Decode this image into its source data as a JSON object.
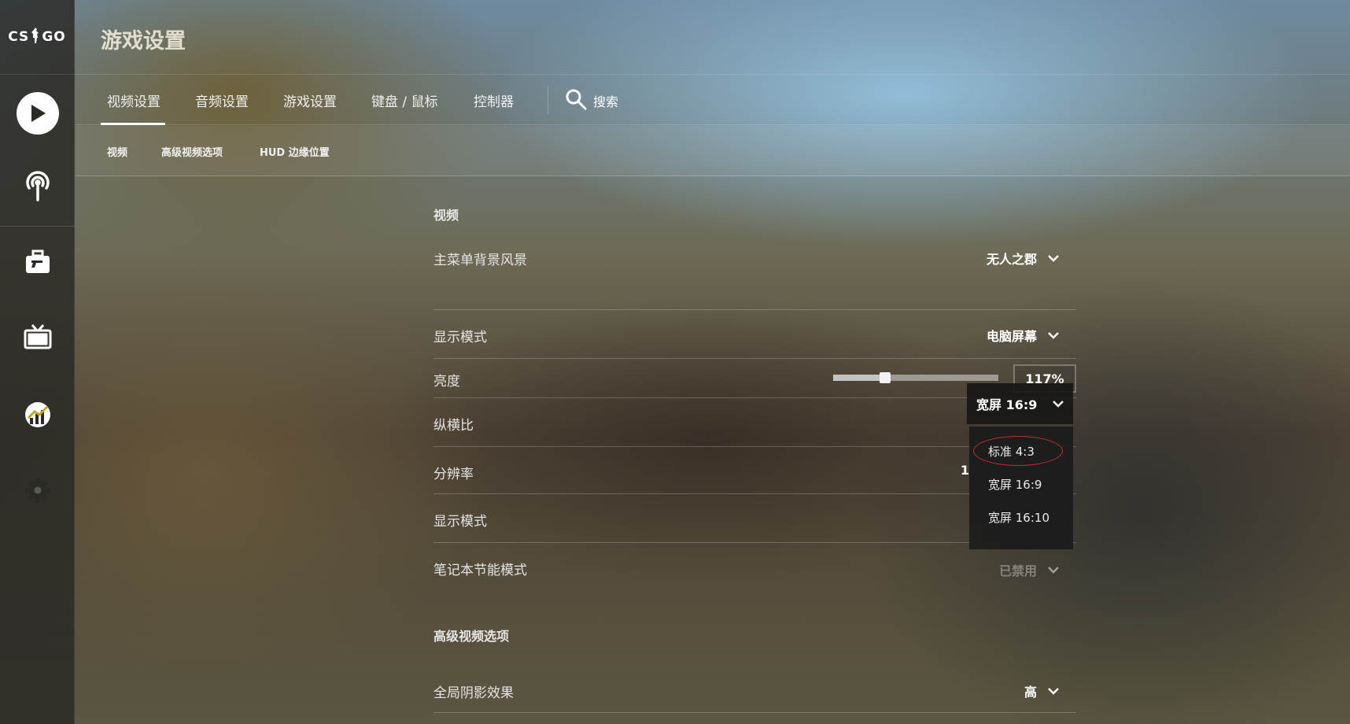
{
  "logo": {
    "left": "CS",
    "right": "GO"
  },
  "header": {
    "title": "游戏设置"
  },
  "tabs": [
    {
      "label": "视频设置",
      "active": true
    },
    {
      "label": "音频设置"
    },
    {
      "label": "游戏设置"
    },
    {
      "label": "键盘 / 鼠标"
    },
    {
      "label": "控制器"
    }
  ],
  "search": {
    "label": "搜索",
    "icon": "search-icon"
  },
  "subtabs": [
    {
      "label": "视频"
    },
    {
      "label": "高级视频选项"
    },
    {
      "label": "HUD 边缘位置"
    }
  ],
  "sections": {
    "video": "视频",
    "advanced": "高级视频选项"
  },
  "settings": {
    "menu_background": {
      "label": "主菜单背景风景",
      "value": "无人之郡"
    },
    "display_mode": {
      "label": "显示模式",
      "value": "电脑屏幕"
    },
    "brightness": {
      "label": "亮度",
      "value": "117%",
      "level": 0.3
    },
    "aspect_ratio": {
      "label": "纵横比",
      "value": "宽屏 16:9"
    },
    "resolution": {
      "label": "分辨率",
      "value_partial": "1"
    },
    "window_mode": {
      "label": "显示模式"
    },
    "laptop_power": {
      "label": "笔记本节能模式",
      "value": "已禁用"
    },
    "global_shadow": {
      "label": "全局阴影效果",
      "value": "高"
    }
  },
  "aspect_dropdown": {
    "options": [
      "标准 4:3",
      "宽屏 16:9",
      "宽屏 16:10"
    ],
    "highlighted": "标准 4:3"
  },
  "colors": {
    "highlight_ring": "#c8302e"
  }
}
